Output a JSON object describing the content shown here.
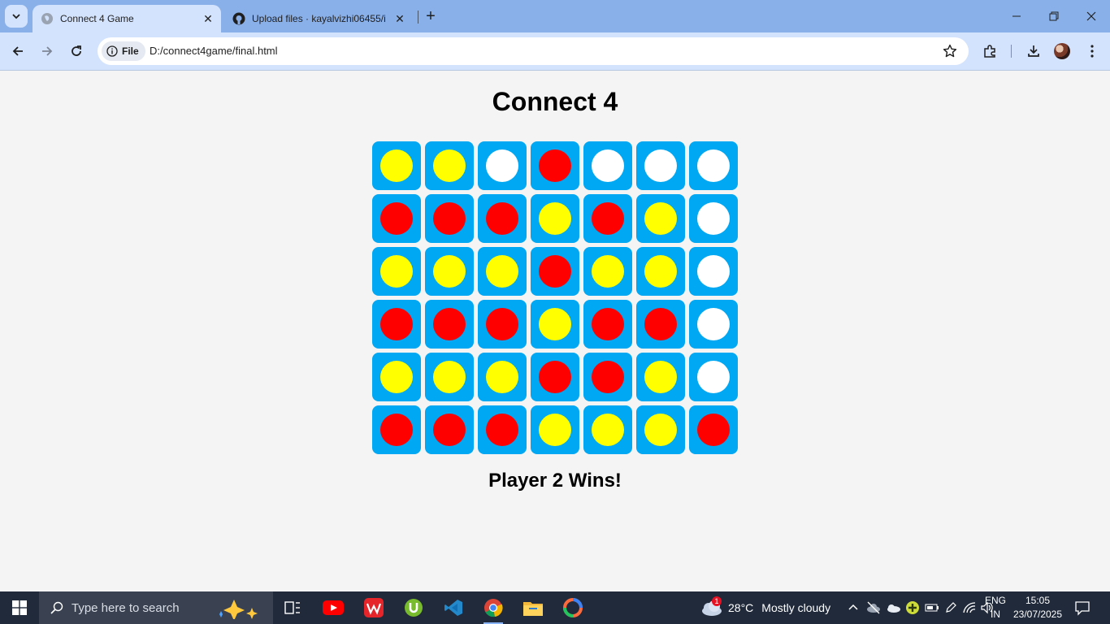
{
  "browser": {
    "tabs": [
      {
        "title": "Connect 4 Game",
        "active": true
      },
      {
        "title": "Upload files · kayalvizhi06455/i",
        "active": false
      }
    ],
    "address": {
      "scheme_chip": "File",
      "url": "D:/connect4game/final.html"
    }
  },
  "game": {
    "title": "Connect 4",
    "status": "Player 2 Wins!",
    "colors": {
      "board_cell": "#00a8f3",
      "red": "#ff0000",
      "yellow": "#ffff00",
      "empty": "#ffffff"
    },
    "board": [
      [
        "yellow",
        "yellow",
        "empty",
        "red",
        "empty",
        "empty",
        "empty"
      ],
      [
        "red",
        "red",
        "red",
        "yellow",
        "red",
        "yellow",
        "empty"
      ],
      [
        "yellow",
        "yellow",
        "yellow",
        "red",
        "yellow",
        "yellow",
        "empty"
      ],
      [
        "red",
        "red",
        "red",
        "yellow",
        "red",
        "red",
        "empty"
      ],
      [
        "yellow",
        "yellow",
        "yellow",
        "red",
        "red",
        "yellow",
        "empty"
      ],
      [
        "red",
        "red",
        "red",
        "yellow",
        "yellow",
        "yellow",
        "red"
      ]
    ]
  },
  "taskbar": {
    "search_placeholder": "Type here to search",
    "weather": {
      "temp": "28°C",
      "condition": "Mostly cloudy",
      "badge": "1"
    },
    "language": {
      "line1": "ENG",
      "line2": "IN"
    },
    "clock": {
      "time": "15:05",
      "date": "23/07/2025"
    },
    "apps": [
      "task-view-icon",
      "youtube-icon",
      "wps-office-icon",
      "utorrent-icon",
      "vscode-icon",
      "chrome-icon",
      "file-explorer-icon",
      "copilot-icon"
    ]
  }
}
